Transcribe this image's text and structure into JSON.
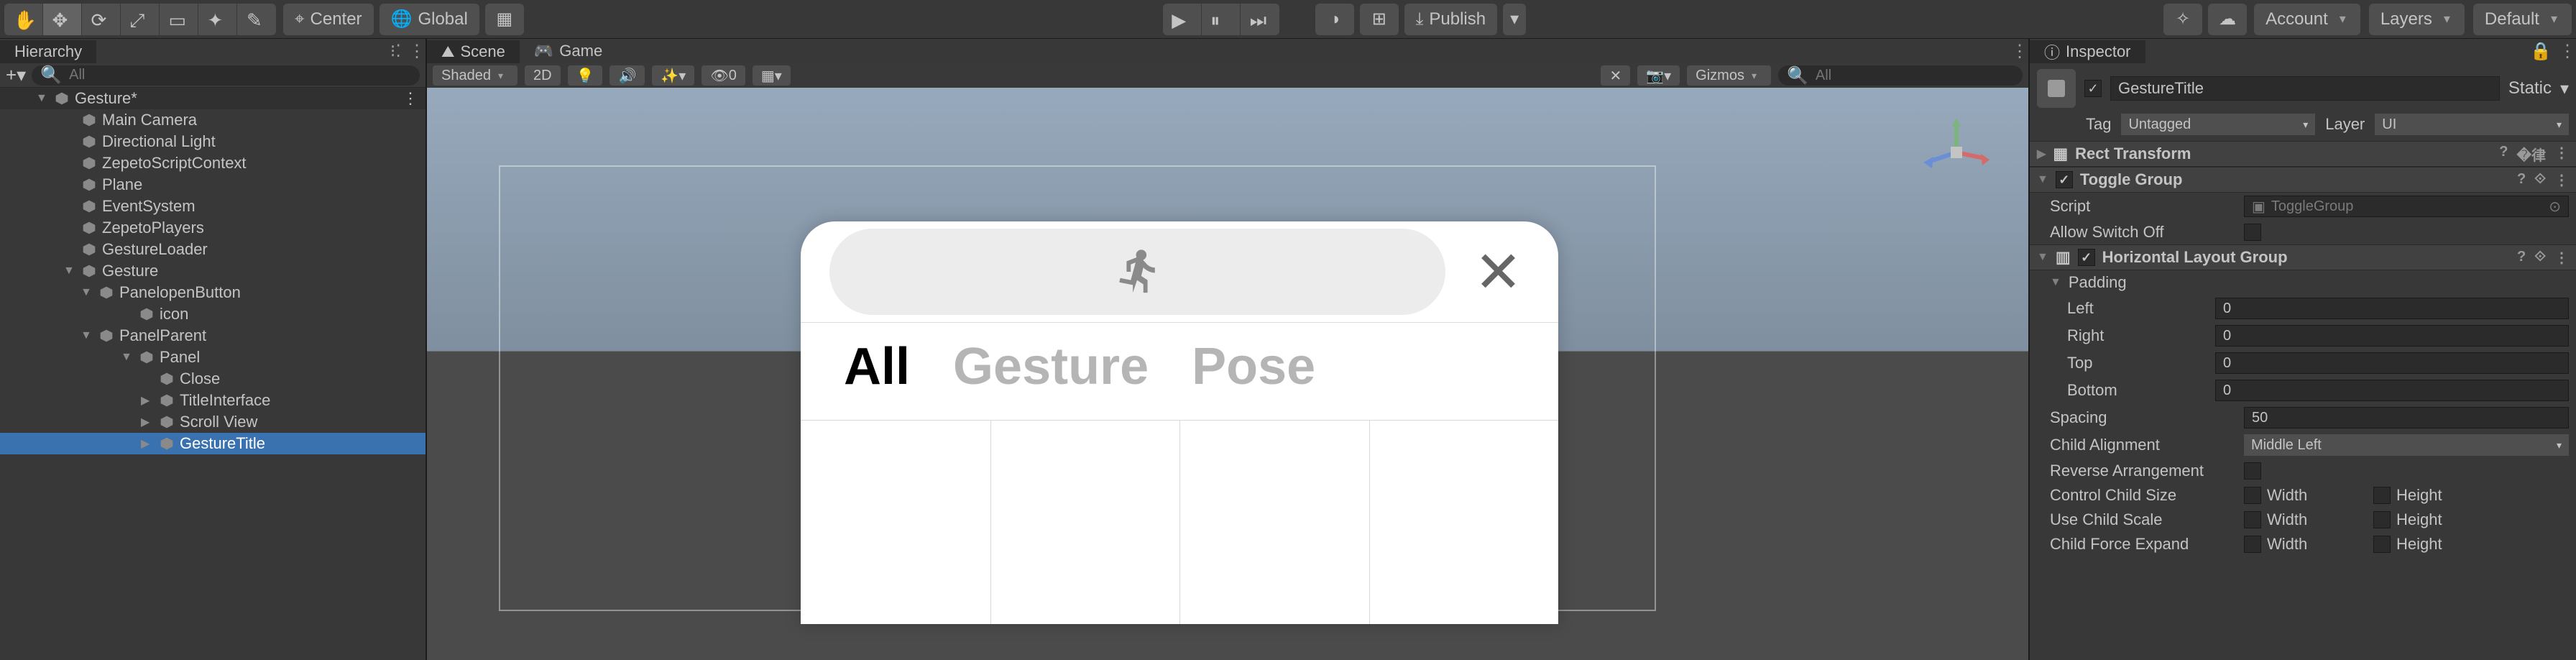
{
  "toolbar": {
    "pivot_label": "Center",
    "space_label": "Global",
    "publish_label": "Publish",
    "account_label": "Account",
    "layers_label": "Layers",
    "layout_label": "Default"
  },
  "hierarchy": {
    "title": "Hierarchy",
    "search_placeholder": "All",
    "scene_name": "Gesture*",
    "items": [
      {
        "label": "Main Camera",
        "indent": 88
      },
      {
        "label": "Directional Light",
        "indent": 88
      },
      {
        "label": "ZepetoScriptContext",
        "indent": 88
      },
      {
        "label": "Plane",
        "indent": 88
      },
      {
        "label": "EventSystem",
        "indent": 88
      },
      {
        "label": "ZepetoPlayers",
        "indent": 88
      },
      {
        "label": "GestureLoader",
        "indent": 88
      },
      {
        "label": "Gesture",
        "indent": 88,
        "arrow": "▼"
      },
      {
        "label": "PanelopenButton",
        "indent": 112,
        "arrow": "▼"
      },
      {
        "label": "icon",
        "indent": 168
      },
      {
        "label": "PanelParent",
        "indent": 112,
        "arrow": "▼"
      },
      {
        "label": "Panel",
        "indent": 168,
        "arrow": "▼"
      },
      {
        "label": "Close",
        "indent": 196
      },
      {
        "label": "TitleInterface",
        "indent": 196,
        "arrow": "▶"
      },
      {
        "label": "Scroll View",
        "indent": 196,
        "arrow": "▶"
      },
      {
        "label": "GestureTitle",
        "indent": 196,
        "arrow": "▶",
        "selected": true
      }
    ]
  },
  "scene": {
    "tab_scene": "Scene",
    "tab_game": "Game",
    "shading": "Shaded",
    "mode_2d": "2D",
    "gizmos": "Gizmos",
    "search_placeholder": "All",
    "count": "0",
    "card_tabs": {
      "all": "All",
      "gesture": "Gesture",
      "pose": "Pose"
    }
  },
  "inspector": {
    "title": "Inspector",
    "go_name": "GestureTitle",
    "static_label": "Static",
    "tag_label": "Tag",
    "tag_value": "Untagged",
    "layer_label": "Layer",
    "layer_value": "UI",
    "rect_transform": "Rect Transform",
    "toggle_group": {
      "title": "Toggle Group",
      "script_label": "Script",
      "script_value": "ToggleGroup",
      "allow_switch_off": "Allow Switch Off"
    },
    "hlg": {
      "title": "Horizontal Layout Group",
      "padding": "Padding",
      "left": "Left",
      "left_v": "0",
      "right": "Right",
      "right_v": "0",
      "top": "Top",
      "top_v": "0",
      "bottom": "Bottom",
      "bottom_v": "0",
      "spacing": "Spacing",
      "spacing_v": "50",
      "child_alignment": "Child Alignment",
      "child_alignment_v": "Middle Left",
      "reverse": "Reverse Arrangement",
      "control_size": "Control Child Size",
      "use_scale": "Use Child Scale",
      "force_expand": "Child Force Expand",
      "width": "Width",
      "height": "Height"
    }
  }
}
